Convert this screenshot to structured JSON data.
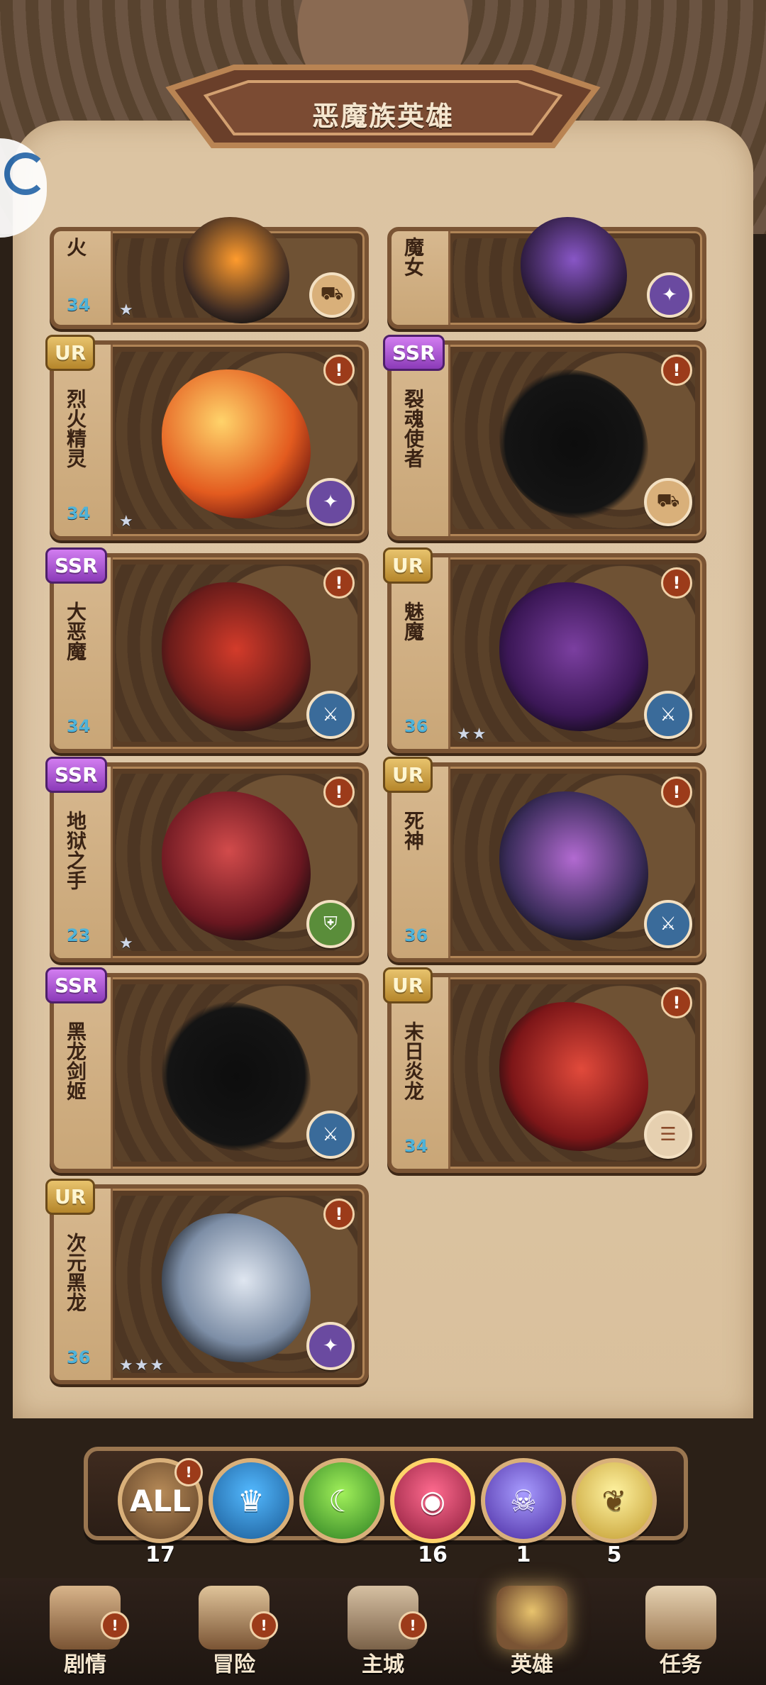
{
  "header": {
    "title": "恶魔族英雄"
  },
  "heroes": [
    {
      "id": "r0l",
      "name": "火",
      "level": "34",
      "rarity": "",
      "stars": "★",
      "alert": "",
      "art": "partial-fire",
      "class": "tank"
    },
    {
      "id": "r0r",
      "name": "魔女",
      "level": "",
      "rarity": "",
      "stars": "",
      "alert": "",
      "art": "partial-witch",
      "class": "mage"
    },
    {
      "id": "r1l",
      "name": "烈火精灵",
      "level": "34",
      "rarity": "UR",
      "stars": "★",
      "alert": "!",
      "art": "fire",
      "class": "mage"
    },
    {
      "id": "r1r",
      "name": "裂魂使者",
      "level": "",
      "rarity": "SSR",
      "stars": "",
      "alert": "!",
      "art": "shadow",
      "class": "tank"
    },
    {
      "id": "r2l",
      "name": "大恶魔",
      "level": "34",
      "rarity": "SSR",
      "stars": "",
      "alert": "!",
      "art": "demon",
      "class": "warrior"
    },
    {
      "id": "r2r",
      "name": "魅魔",
      "level": "36",
      "rarity": "UR",
      "stars": "★★",
      "alert": "!",
      "art": "succubus",
      "class": "warrior"
    },
    {
      "id": "r3l",
      "name": "地狱之手",
      "level": "23",
      "rarity": "SSR",
      "stars": "★",
      "alert": "!",
      "art": "hellhand",
      "class": "support"
    },
    {
      "id": "r3r",
      "name": "死神",
      "level": "36",
      "rarity": "UR",
      "stars": "",
      "alert": "!",
      "art": "death",
      "class": "warrior"
    },
    {
      "id": "r4l",
      "name": "黑龙剑姬",
      "level": "",
      "rarity": "SSR",
      "stars": "",
      "alert": "",
      "art": "shadow",
      "class": "warrior"
    },
    {
      "id": "r4r",
      "name": "末日炎龙",
      "level": "34",
      "rarity": "UR",
      "stars": "",
      "alert": "!",
      "art": "dragon",
      "class": "scroll"
    },
    {
      "id": "r5l",
      "name": "次元黑龙",
      "level": "36",
      "rarity": "UR",
      "stars": "★★★",
      "alert": "!",
      "art": "void",
      "class": "mage"
    }
  ],
  "filters": [
    {
      "key": "all",
      "label": "ALL",
      "count": "17",
      "badge": "!"
    },
    {
      "key": "blue",
      "label": "",
      "count": "",
      "badge": ""
    },
    {
      "key": "green",
      "label": "",
      "count": "",
      "badge": ""
    },
    {
      "key": "red",
      "label": "",
      "count": "16",
      "badge": ""
    },
    {
      "key": "purple",
      "label": "",
      "count": "1",
      "badge": ""
    },
    {
      "key": "yellow",
      "label": "",
      "count": "5",
      "badge": ""
    }
  ],
  "nav": [
    {
      "label": "剧情",
      "badge": "!"
    },
    {
      "label": "冒险",
      "badge": "!"
    },
    {
      "label": "主城",
      "badge": "!"
    },
    {
      "label": "英雄",
      "badge": ""
    },
    {
      "label": "任务",
      "badge": ""
    }
  ]
}
